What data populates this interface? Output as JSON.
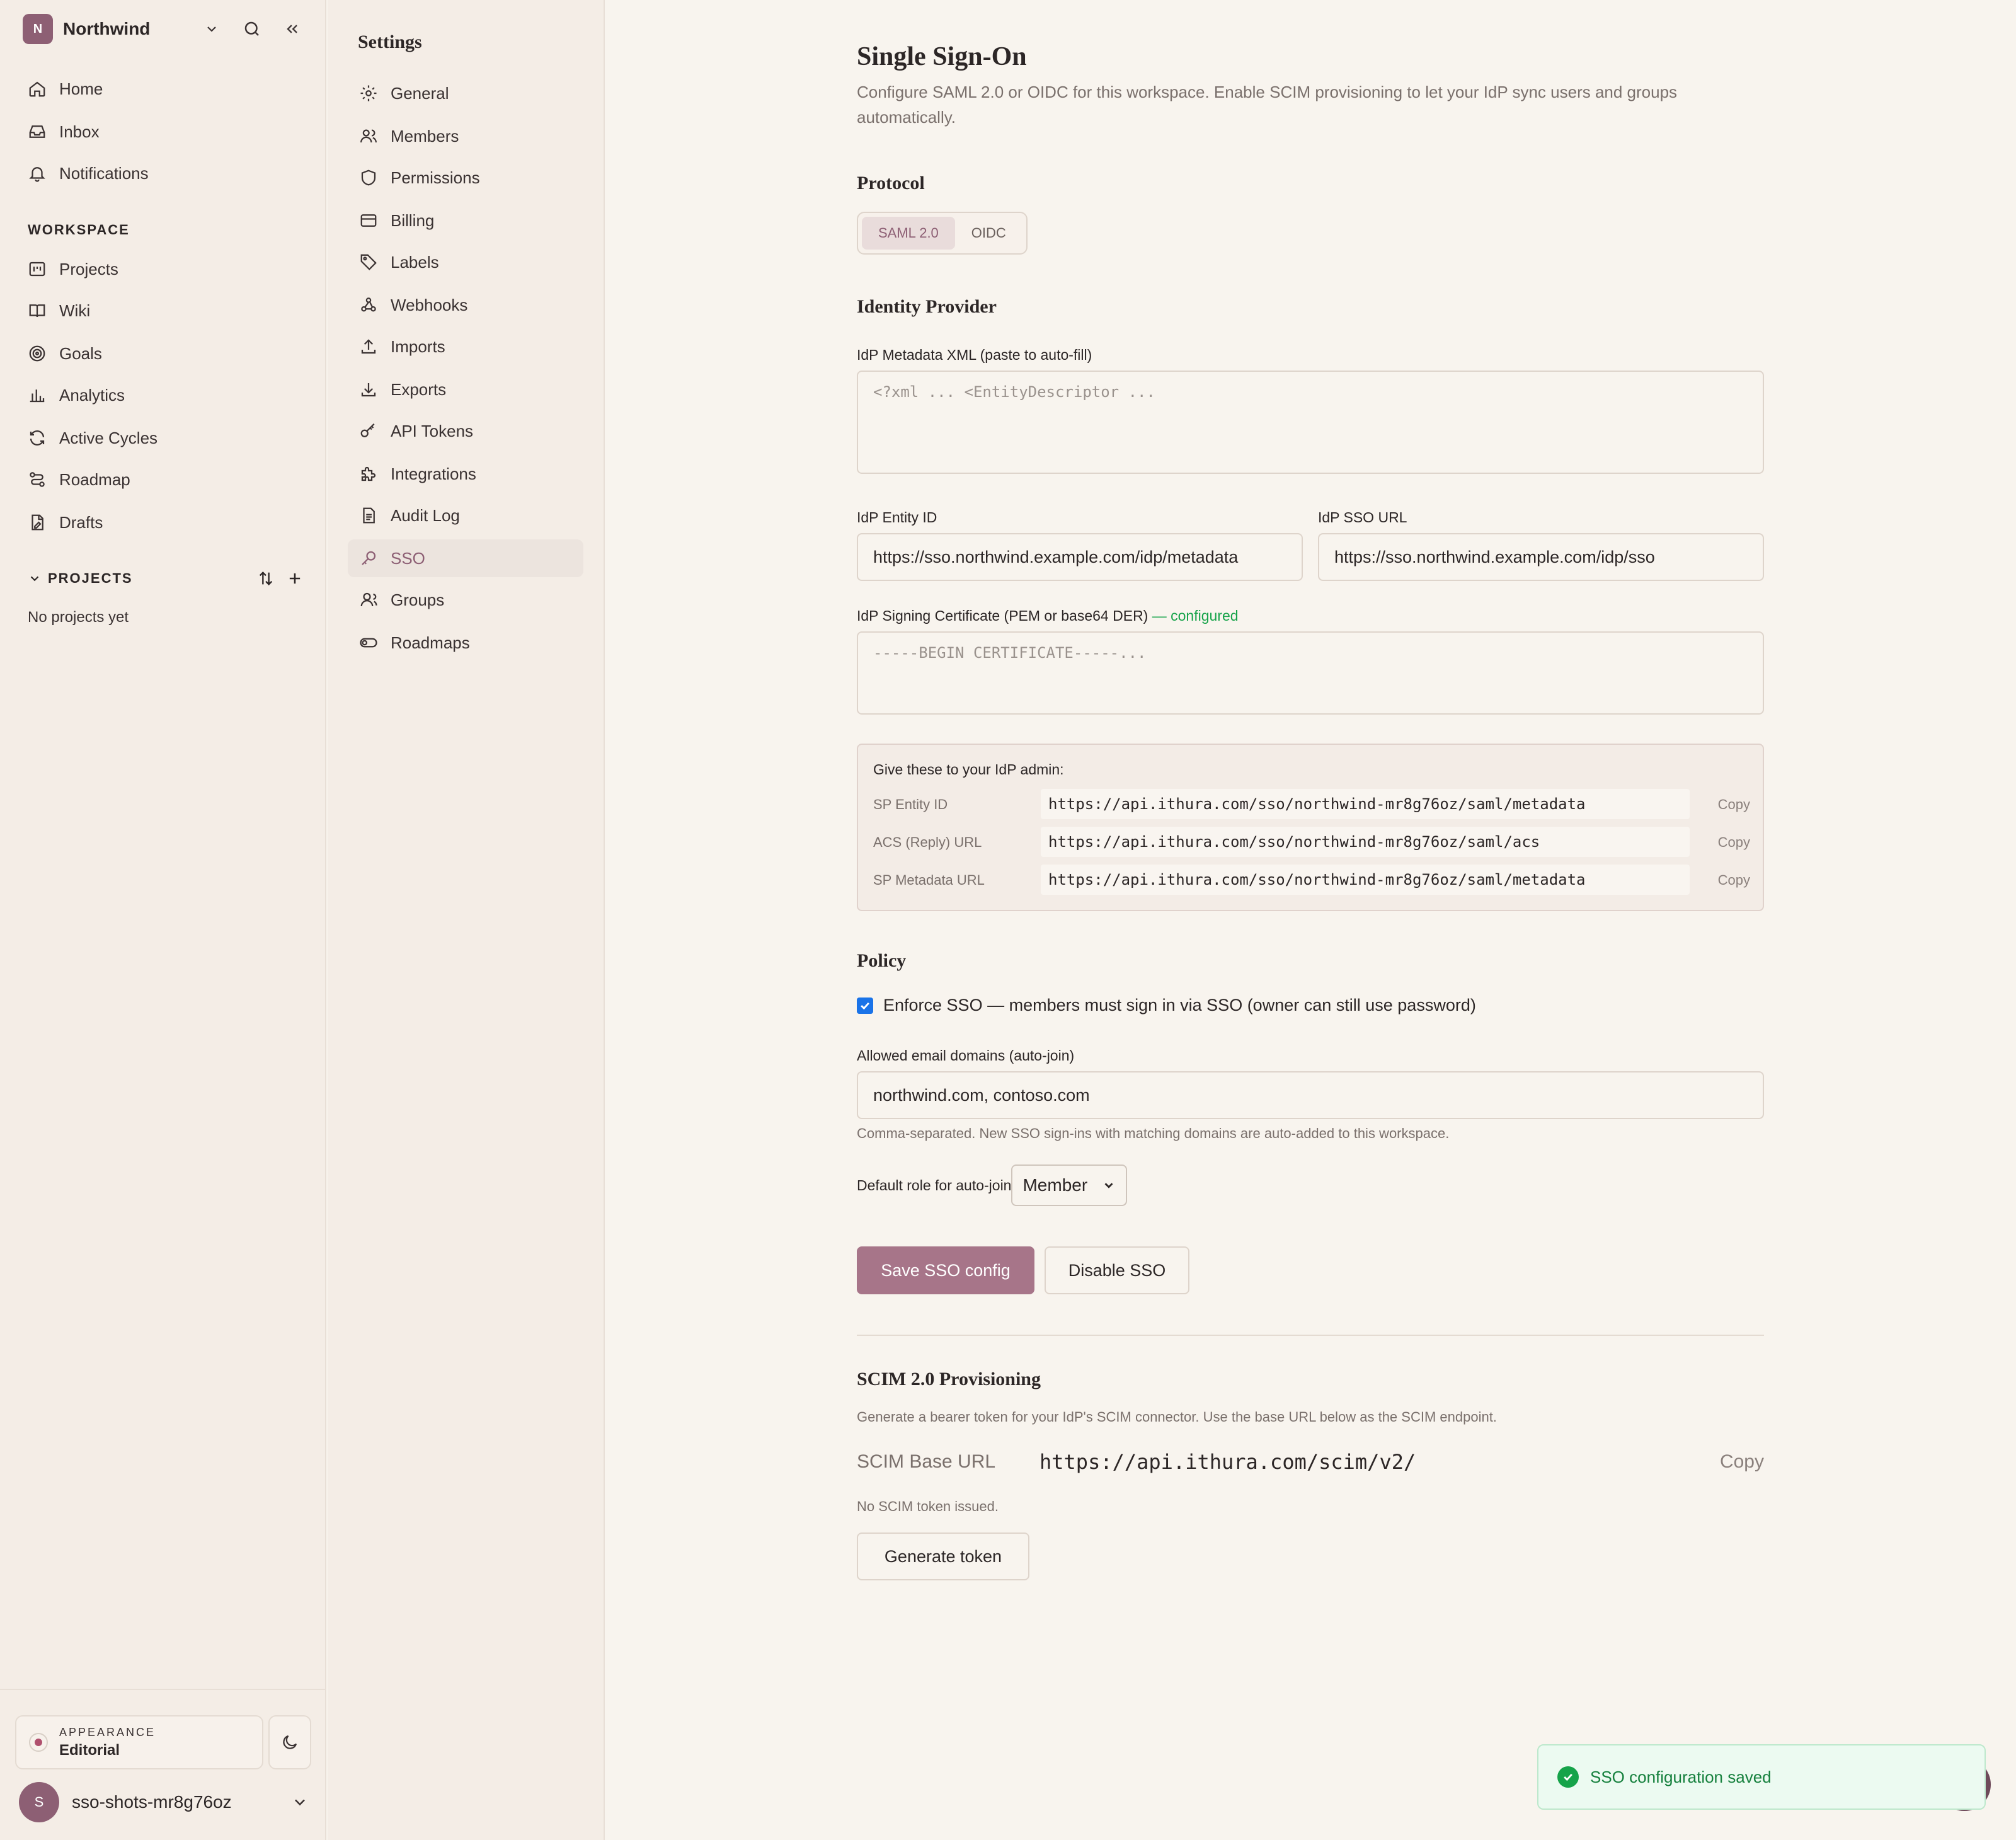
{
  "workspace": {
    "initial": "N",
    "name": "Northwind"
  },
  "nav": {
    "top": [
      "Home",
      "Inbox",
      "Notifications"
    ],
    "workspace_label": "WORKSPACE",
    "workspace": [
      "Projects",
      "Wiki",
      "Goals",
      "Analytics",
      "Active Cycles",
      "Roadmap",
      "Drafts"
    ],
    "projects_label": "PROJECTS",
    "projects_empty": "No projects yet"
  },
  "appearance": {
    "label": "APPEARANCE",
    "value": "Editorial"
  },
  "user": {
    "initial": "S",
    "name": "sso-shots-mr8g76oz"
  },
  "settings": {
    "title": "Settings",
    "items": [
      "General",
      "Members",
      "Permissions",
      "Billing",
      "Labels",
      "Webhooks",
      "Imports",
      "Exports",
      "API Tokens",
      "Integrations",
      "Audit Log",
      "SSO",
      "Groups",
      "Roadmaps"
    ],
    "active": "SSO"
  },
  "page": {
    "title": "Single Sign-On",
    "description": "Configure SAML 2.0 or OIDC for this workspace. Enable SCIM provisioning to let your IdP sync users and groups automatically."
  },
  "protocol": {
    "heading": "Protocol",
    "options": [
      "SAML 2.0",
      "OIDC"
    ],
    "selected": "SAML 2.0"
  },
  "idp": {
    "heading": "Identity Provider",
    "metadata_label": "IdP Metadata XML (paste to auto-fill)",
    "metadata_placeholder": "<?xml ... <EntityDescriptor ...",
    "entity_id_label": "IdP Entity ID",
    "entity_id_value": "https://sso.northwind.example.com/idp/metadata",
    "sso_url_label": "IdP SSO URL",
    "sso_url_value": "https://sso.northwind.example.com/idp/sso",
    "cert_label": "IdP Signing Certificate (PEM or base64 DER)",
    "cert_status": "— configured",
    "cert_placeholder": "-----BEGIN CERTIFICATE-----..."
  },
  "sp": {
    "title": "Give these to your IdP admin:",
    "copy_label": "Copy",
    "rows": [
      {
        "key": "SP Entity ID",
        "value": "https://api.ithura.com/sso/northwind-mr8g76oz/saml/metadata"
      },
      {
        "key": "ACS (Reply) URL",
        "value": "https://api.ithura.com/sso/northwind-mr8g76oz/saml/acs"
      },
      {
        "key": "SP Metadata URL",
        "value": "https://api.ithura.com/sso/northwind-mr8g76oz/saml/metadata"
      }
    ]
  },
  "policy": {
    "heading": "Policy",
    "enforce_label": "Enforce SSO — members must sign in via SSO (owner can still use password)",
    "enforce_checked": true,
    "domains_label": "Allowed email domains (auto-join)",
    "domains_value": "northwind.com, contoso.com",
    "domains_help": "Comma-separated. New SSO sign-ins with matching domains are auto-added to this workspace.",
    "role_label": "Default role for auto-join",
    "role_value": "Member",
    "save_label": "Save SSO config",
    "disable_label": "Disable SSO"
  },
  "scim": {
    "heading": "SCIM 2.0 Provisioning",
    "description": "Generate a bearer token for your IdP's SCIM connector. Use the base URL below as the SCIM endpoint.",
    "base_url_label": "SCIM Base URL",
    "base_url_value": "https://api.ithura.com/scim/v2/",
    "copy_label": "Copy",
    "token_status": "No SCIM token issued.",
    "generate_label": "Generate token"
  },
  "toast": {
    "message": "SSO configuration saved"
  },
  "colors": {
    "accent": "#8d5f74",
    "primary_button": "#a77589",
    "success": "#16a34a",
    "background": "#f8f4ee",
    "sidebar": "#f4ede6"
  }
}
